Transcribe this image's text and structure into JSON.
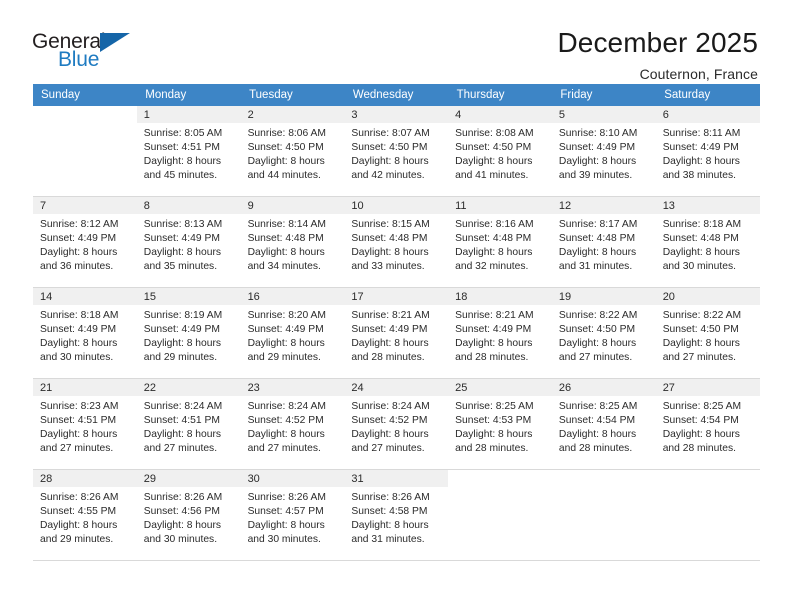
{
  "brand": {
    "name_top": "General",
    "name_bottom": "Blue",
    "colors": {
      "dark": "#231f20",
      "blue": "#1f7bc1",
      "triangle": "#1565a8"
    }
  },
  "header": {
    "title": "December 2025",
    "location": "Couternon, France"
  },
  "calendar": {
    "header_bg": "#3d85c6",
    "daynum_bg": "#f0f0f0",
    "weekdays": [
      "Sunday",
      "Monday",
      "Tuesday",
      "Wednesday",
      "Thursday",
      "Friday",
      "Saturday"
    ],
    "weeks": [
      [
        {
          "day": "",
          "sunrise": "",
          "sunset": "",
          "daylight_line1": "",
          "daylight_line2": "",
          "blank": true
        },
        {
          "day": "1",
          "sunrise": "Sunrise: 8:05 AM",
          "sunset": "Sunset: 4:51 PM",
          "daylight_line1": "Daylight: 8 hours",
          "daylight_line2": "and 45 minutes."
        },
        {
          "day": "2",
          "sunrise": "Sunrise: 8:06 AM",
          "sunset": "Sunset: 4:50 PM",
          "daylight_line1": "Daylight: 8 hours",
          "daylight_line2": "and 44 minutes."
        },
        {
          "day": "3",
          "sunrise": "Sunrise: 8:07 AM",
          "sunset": "Sunset: 4:50 PM",
          "daylight_line1": "Daylight: 8 hours",
          "daylight_line2": "and 42 minutes."
        },
        {
          "day": "4",
          "sunrise": "Sunrise: 8:08 AM",
          "sunset": "Sunset: 4:50 PM",
          "daylight_line1": "Daylight: 8 hours",
          "daylight_line2": "and 41 minutes."
        },
        {
          "day": "5",
          "sunrise": "Sunrise: 8:10 AM",
          "sunset": "Sunset: 4:49 PM",
          "daylight_line1": "Daylight: 8 hours",
          "daylight_line2": "and 39 minutes."
        },
        {
          "day": "6",
          "sunrise": "Sunrise: 8:11 AM",
          "sunset": "Sunset: 4:49 PM",
          "daylight_line1": "Daylight: 8 hours",
          "daylight_line2": "and 38 minutes."
        }
      ],
      [
        {
          "day": "7",
          "sunrise": "Sunrise: 8:12 AM",
          "sunset": "Sunset: 4:49 PM",
          "daylight_line1": "Daylight: 8 hours",
          "daylight_line2": "and 36 minutes."
        },
        {
          "day": "8",
          "sunrise": "Sunrise: 8:13 AM",
          "sunset": "Sunset: 4:49 PM",
          "daylight_line1": "Daylight: 8 hours",
          "daylight_line2": "and 35 minutes."
        },
        {
          "day": "9",
          "sunrise": "Sunrise: 8:14 AM",
          "sunset": "Sunset: 4:48 PM",
          "daylight_line1": "Daylight: 8 hours",
          "daylight_line2": "and 34 minutes."
        },
        {
          "day": "10",
          "sunrise": "Sunrise: 8:15 AM",
          "sunset": "Sunset: 4:48 PM",
          "daylight_line1": "Daylight: 8 hours",
          "daylight_line2": "and 33 minutes."
        },
        {
          "day": "11",
          "sunrise": "Sunrise: 8:16 AM",
          "sunset": "Sunset: 4:48 PM",
          "daylight_line1": "Daylight: 8 hours",
          "daylight_line2": "and 32 minutes."
        },
        {
          "day": "12",
          "sunrise": "Sunrise: 8:17 AM",
          "sunset": "Sunset: 4:48 PM",
          "daylight_line1": "Daylight: 8 hours",
          "daylight_line2": "and 31 minutes."
        },
        {
          "day": "13",
          "sunrise": "Sunrise: 8:18 AM",
          "sunset": "Sunset: 4:48 PM",
          "daylight_line1": "Daylight: 8 hours",
          "daylight_line2": "and 30 minutes."
        }
      ],
      [
        {
          "day": "14",
          "sunrise": "Sunrise: 8:18 AM",
          "sunset": "Sunset: 4:49 PM",
          "daylight_line1": "Daylight: 8 hours",
          "daylight_line2": "and 30 minutes."
        },
        {
          "day": "15",
          "sunrise": "Sunrise: 8:19 AM",
          "sunset": "Sunset: 4:49 PM",
          "daylight_line1": "Daylight: 8 hours",
          "daylight_line2": "and 29 minutes."
        },
        {
          "day": "16",
          "sunrise": "Sunrise: 8:20 AM",
          "sunset": "Sunset: 4:49 PM",
          "daylight_line1": "Daylight: 8 hours",
          "daylight_line2": "and 29 minutes."
        },
        {
          "day": "17",
          "sunrise": "Sunrise: 8:21 AM",
          "sunset": "Sunset: 4:49 PM",
          "daylight_line1": "Daylight: 8 hours",
          "daylight_line2": "and 28 minutes."
        },
        {
          "day": "18",
          "sunrise": "Sunrise: 8:21 AM",
          "sunset": "Sunset: 4:49 PM",
          "daylight_line1": "Daylight: 8 hours",
          "daylight_line2": "and 28 minutes."
        },
        {
          "day": "19",
          "sunrise": "Sunrise: 8:22 AM",
          "sunset": "Sunset: 4:50 PM",
          "daylight_line1": "Daylight: 8 hours",
          "daylight_line2": "and 27 minutes."
        },
        {
          "day": "20",
          "sunrise": "Sunrise: 8:22 AM",
          "sunset": "Sunset: 4:50 PM",
          "daylight_line1": "Daylight: 8 hours",
          "daylight_line2": "and 27 minutes."
        }
      ],
      [
        {
          "day": "21",
          "sunrise": "Sunrise: 8:23 AM",
          "sunset": "Sunset: 4:51 PM",
          "daylight_line1": "Daylight: 8 hours",
          "daylight_line2": "and 27 minutes."
        },
        {
          "day": "22",
          "sunrise": "Sunrise: 8:24 AM",
          "sunset": "Sunset: 4:51 PM",
          "daylight_line1": "Daylight: 8 hours",
          "daylight_line2": "and 27 minutes."
        },
        {
          "day": "23",
          "sunrise": "Sunrise: 8:24 AM",
          "sunset": "Sunset: 4:52 PM",
          "daylight_line1": "Daylight: 8 hours",
          "daylight_line2": "and 27 minutes."
        },
        {
          "day": "24",
          "sunrise": "Sunrise: 8:24 AM",
          "sunset": "Sunset: 4:52 PM",
          "daylight_line1": "Daylight: 8 hours",
          "daylight_line2": "and 27 minutes."
        },
        {
          "day": "25",
          "sunrise": "Sunrise: 8:25 AM",
          "sunset": "Sunset: 4:53 PM",
          "daylight_line1": "Daylight: 8 hours",
          "daylight_line2": "and 28 minutes."
        },
        {
          "day": "26",
          "sunrise": "Sunrise: 8:25 AM",
          "sunset": "Sunset: 4:54 PM",
          "daylight_line1": "Daylight: 8 hours",
          "daylight_line2": "and 28 minutes."
        },
        {
          "day": "27",
          "sunrise": "Sunrise: 8:25 AM",
          "sunset": "Sunset: 4:54 PM",
          "daylight_line1": "Daylight: 8 hours",
          "daylight_line2": "and 28 minutes."
        }
      ],
      [
        {
          "day": "28",
          "sunrise": "Sunrise: 8:26 AM",
          "sunset": "Sunset: 4:55 PM",
          "daylight_line1": "Daylight: 8 hours",
          "daylight_line2": "and 29 minutes."
        },
        {
          "day": "29",
          "sunrise": "Sunrise: 8:26 AM",
          "sunset": "Sunset: 4:56 PM",
          "daylight_line1": "Daylight: 8 hours",
          "daylight_line2": "and 30 minutes."
        },
        {
          "day": "30",
          "sunrise": "Sunrise: 8:26 AM",
          "sunset": "Sunset: 4:57 PM",
          "daylight_line1": "Daylight: 8 hours",
          "daylight_line2": "and 30 minutes."
        },
        {
          "day": "31",
          "sunrise": "Sunrise: 8:26 AM",
          "sunset": "Sunset: 4:58 PM",
          "daylight_line1": "Daylight: 8 hours",
          "daylight_line2": "and 31 minutes."
        },
        {
          "day": "",
          "sunrise": "",
          "sunset": "",
          "daylight_line1": "",
          "daylight_line2": "",
          "blank": true
        },
        {
          "day": "",
          "sunrise": "",
          "sunset": "",
          "daylight_line1": "",
          "daylight_line2": "",
          "blank": true
        },
        {
          "day": "",
          "sunrise": "",
          "sunset": "",
          "daylight_line1": "",
          "daylight_line2": "",
          "blank": true
        }
      ]
    ]
  }
}
